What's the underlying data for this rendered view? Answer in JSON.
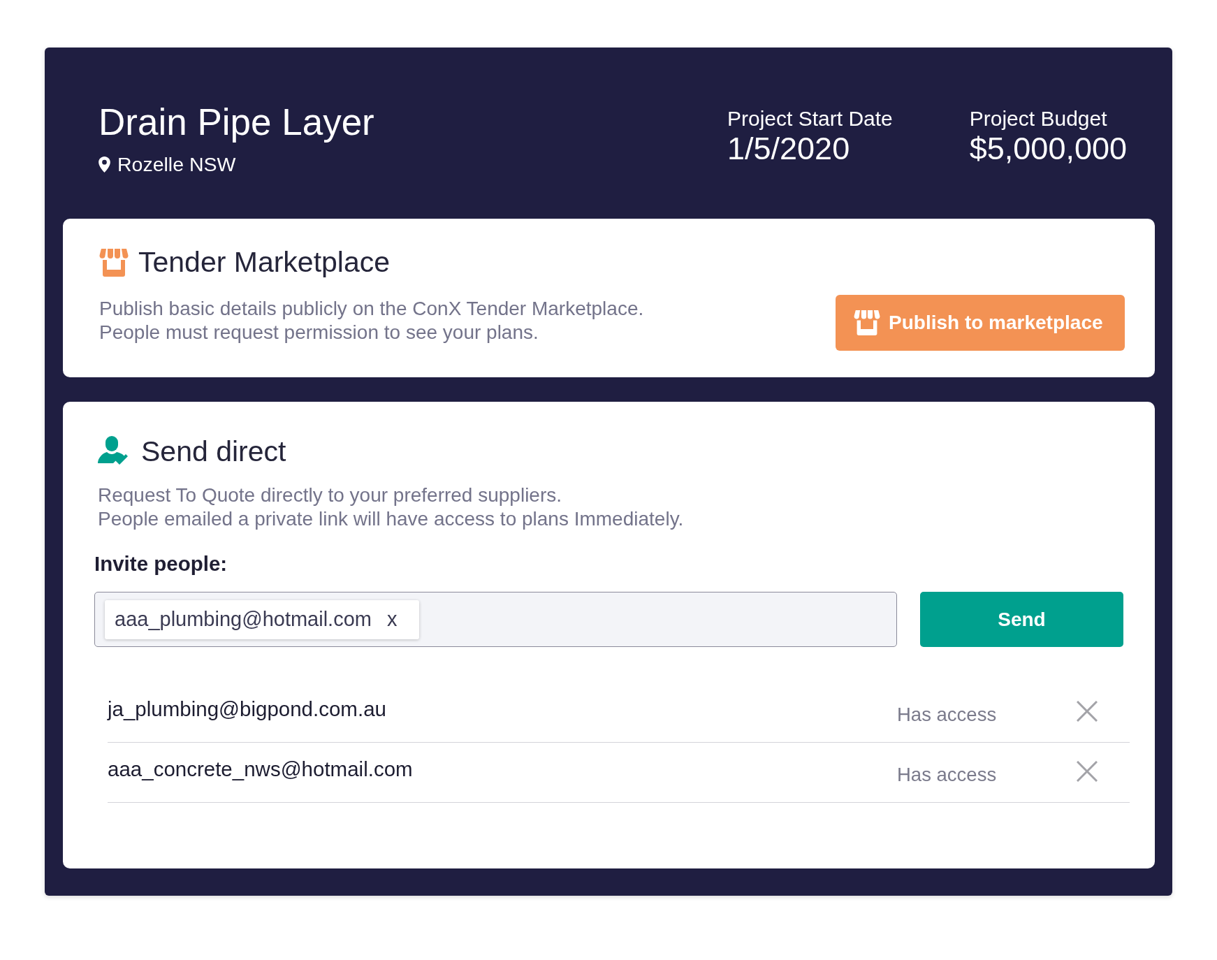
{
  "project": {
    "title": "Drain Pipe Layer",
    "location": "Rozelle NSW",
    "stats": [
      {
        "label": "Project Start Date",
        "value": "1/5/2020"
      },
      {
        "label": "Project Budget",
        "value": "$5,000,000"
      }
    ]
  },
  "tender_marketplace": {
    "title": "Tender Marketplace",
    "description": [
      "Publish basic details publicly on the ConX Tender Marketplace.",
      "People must request permission to see your plans."
    ],
    "button": "Publish to marketplace"
  },
  "send_direct": {
    "title": "Send direct",
    "description": [
      "Request To Quote directly to your preferred suppliers.",
      "People emailed a private link will have access to plans Immediately."
    ],
    "invite_label": "Invite people:",
    "invite_field": {
      "chips": [
        {
          "email": "aaa_plumbing@hotmail.com",
          "remove": "x"
        }
      ]
    },
    "send_button": "Send",
    "recipients": [
      {
        "email": "ja_plumbing@bigpond.com.au",
        "status": "Has access"
      },
      {
        "email": "aaa_concrete_nws@hotmail.com",
        "status": "Has access"
      }
    ]
  }
}
